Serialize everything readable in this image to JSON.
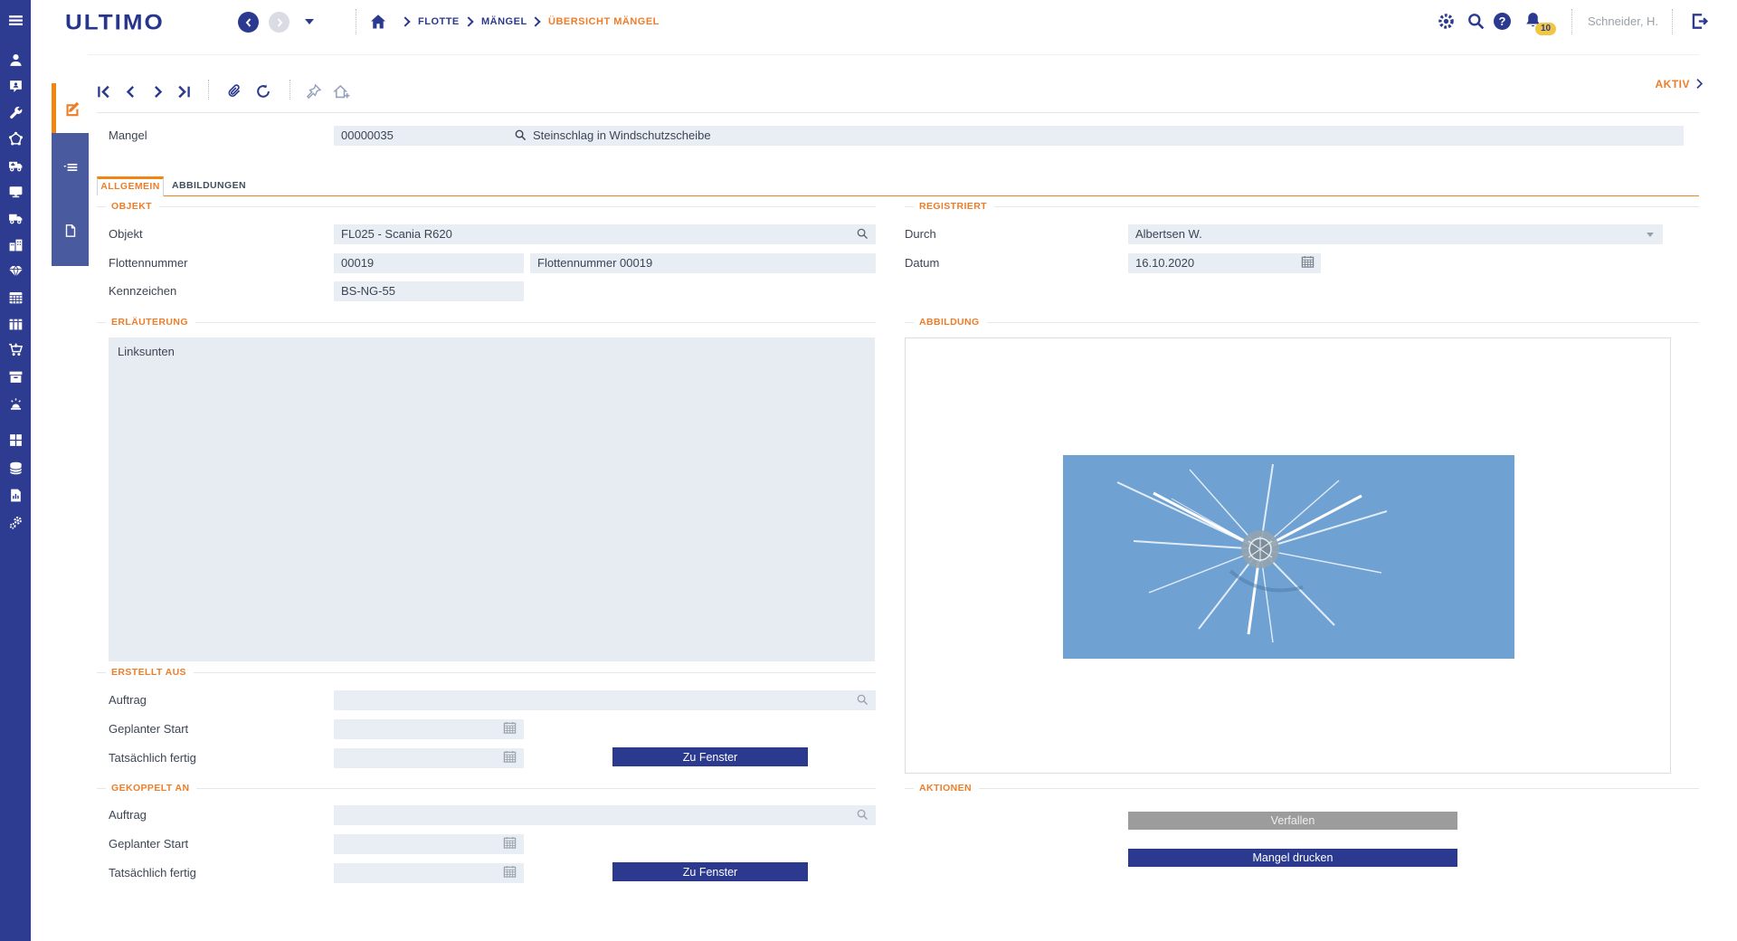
{
  "topbar": {
    "logo": "ULTIMO",
    "breadcrumb": [
      "FLOTTE",
      "MÄNGEL",
      "ÜBERSICHT MÄNGEL"
    ],
    "user": "Schneider, H.",
    "notification_count": "10",
    "help_glyph": "?"
  },
  "record": {
    "status": "AKTIV",
    "field_label": "Mangel",
    "number": "00000035",
    "description": "Steinschlag in Windschutzscheibe"
  },
  "tabs": {
    "allgemein": "ALLGEMEIN",
    "abbildungen": "ABBILDUNGEN"
  },
  "objekt": {
    "title": "OBJEKT",
    "objekt_label": "Objekt",
    "objekt_value": "FL025 - Scania R620",
    "flotte_label": "Flottennummer",
    "flotte_value": "00019",
    "flotte_desc": "Flottennummer 00019",
    "kennzeichen_label": "Kennzeichen",
    "kennzeichen_value": "BS-NG-55"
  },
  "registriert": {
    "title": "REGISTRIERT",
    "durch_label": "Durch",
    "durch_value": "Albertsen W.",
    "datum_label": "Datum",
    "datum_value": "16.10.2020"
  },
  "erlaeuterung": {
    "title": "ERLÄUTERUNG",
    "text": "Linksunten"
  },
  "abbildung": {
    "title": "ABBILDUNG"
  },
  "erstellt_aus": {
    "title": "ERSTELLT AUS",
    "auftrag_label": "Auftrag",
    "auftrag_value": "",
    "start_label": "Geplanter Start",
    "start_value": "",
    "fertig_label": "Tatsächlich fertig",
    "fertig_value": "",
    "button": "Zu Fenster"
  },
  "gekoppelt_an": {
    "title": "GEKOPPELT AN",
    "auftrag_label": "Auftrag",
    "auftrag_value": "",
    "start_label": "Geplanter Start",
    "start_value": "",
    "fertig_label": "Tatsächlich fertig",
    "fertig_value": "",
    "button": "Zu Fenster"
  },
  "aktionen": {
    "title": "AKTIONEN",
    "verfallen": "Verfallen",
    "drucken": "Mangel drucken"
  },
  "colors": {
    "brand_navy": "#2b3a8f",
    "accent_orange": "#ee7d2a",
    "field_bg": "#e9edf4",
    "sidebar_bg": "#2d3c90",
    "strip_bg": "#4a5a9e",
    "disabled_gray": "#9c9c9c",
    "badge_yellow": "#f2c645",
    "photo_blue": "#6fa1d3"
  },
  "sidebar_icons": [
    "menu",
    "user",
    "chat-person",
    "wrench",
    "network",
    "ambulance",
    "monitor",
    "truck",
    "buildings",
    "diamond",
    "calendar",
    "binders",
    "cart",
    "box",
    "siren",
    "grid",
    "database",
    "report",
    "gears"
  ]
}
